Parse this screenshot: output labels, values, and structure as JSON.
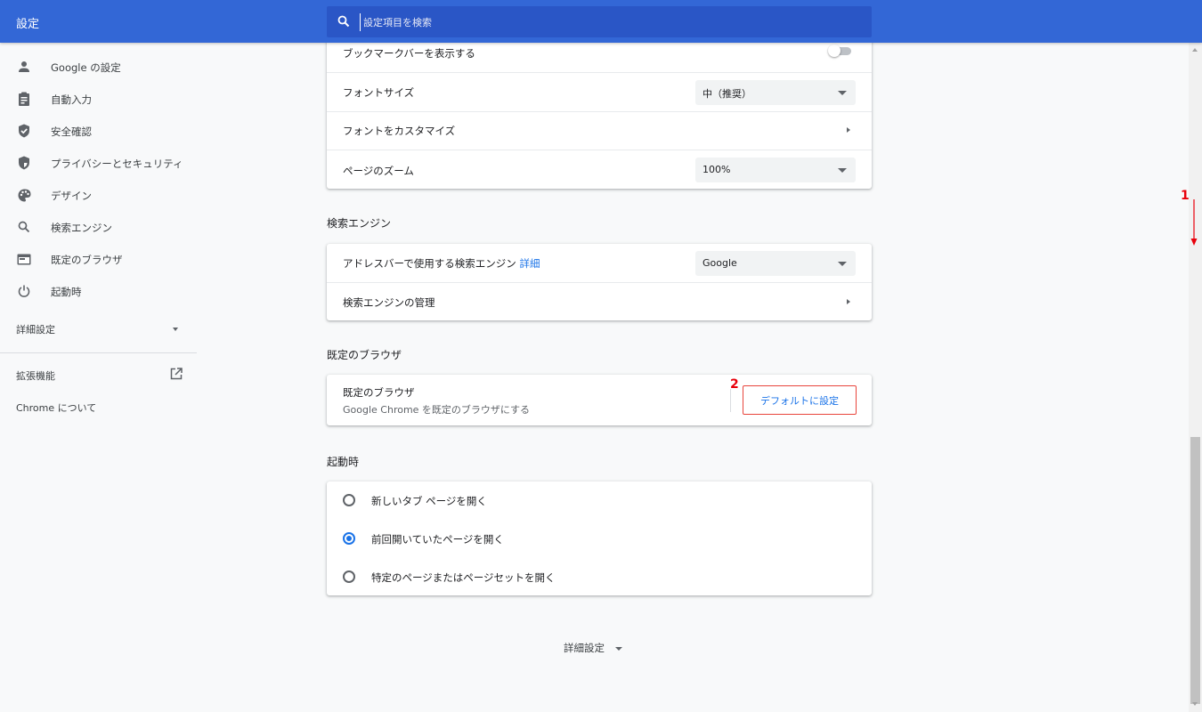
{
  "header": {
    "title": "設定",
    "search_placeholder": "設定項目を検索"
  },
  "sidebar": {
    "items": [
      {
        "label": "Google の設定",
        "icon": "person-icon"
      },
      {
        "label": "自動入力",
        "icon": "clipboard-icon"
      },
      {
        "label": "安全確認",
        "icon": "shield-check-icon"
      },
      {
        "label": "プライバシーとセキュリティ",
        "icon": "privacy-shield-icon"
      },
      {
        "label": "デザイン",
        "icon": "palette-icon"
      },
      {
        "label": "検索エンジン",
        "icon": "search-icon"
      },
      {
        "label": "既定のブラウザ",
        "icon": "browser-icon"
      },
      {
        "label": "起動時",
        "icon": "power-icon"
      }
    ],
    "advanced_label": "詳細設定",
    "extensions_label": "拡張機能",
    "about_label": "Chrome について"
  },
  "appearance": {
    "bookmarks_bar_label": "ブックマークバーを表示する",
    "bookmarks_bar_on": false,
    "font_size_label": "フォントサイズ",
    "font_size_value": "中（推奨）",
    "customize_fonts_label": "フォントをカスタマイズ",
    "page_zoom_label": "ページのズーム",
    "page_zoom_value": "100%"
  },
  "search_engine": {
    "section_title": "検索エンジン",
    "address_bar_label": "アドレスバーで使用する検索エンジン",
    "details_link": "詳細",
    "engine_value": "Google",
    "manage_label": "検索エンジンの管理"
  },
  "default_browser": {
    "section_title": "既定のブラウザ",
    "title": "既定のブラウザ",
    "subtitle": "Google Chrome を既定のブラウザにする",
    "button_label": "デフォルトに設定"
  },
  "on_startup": {
    "section_title": "起動時",
    "options": [
      {
        "label": "新しいタブ ページを開く",
        "selected": false
      },
      {
        "label": "前回開いていたページを開く",
        "selected": true
      },
      {
        "label": "特定のページまたはページセットを開く",
        "selected": false
      }
    ]
  },
  "footer": {
    "advanced_label": "詳細設定"
  },
  "annotations": {
    "step1": "1",
    "step2": "2"
  },
  "colors": {
    "header": "#3367d6",
    "accent": "#1a73e8",
    "annotation": "#e8000b"
  }
}
